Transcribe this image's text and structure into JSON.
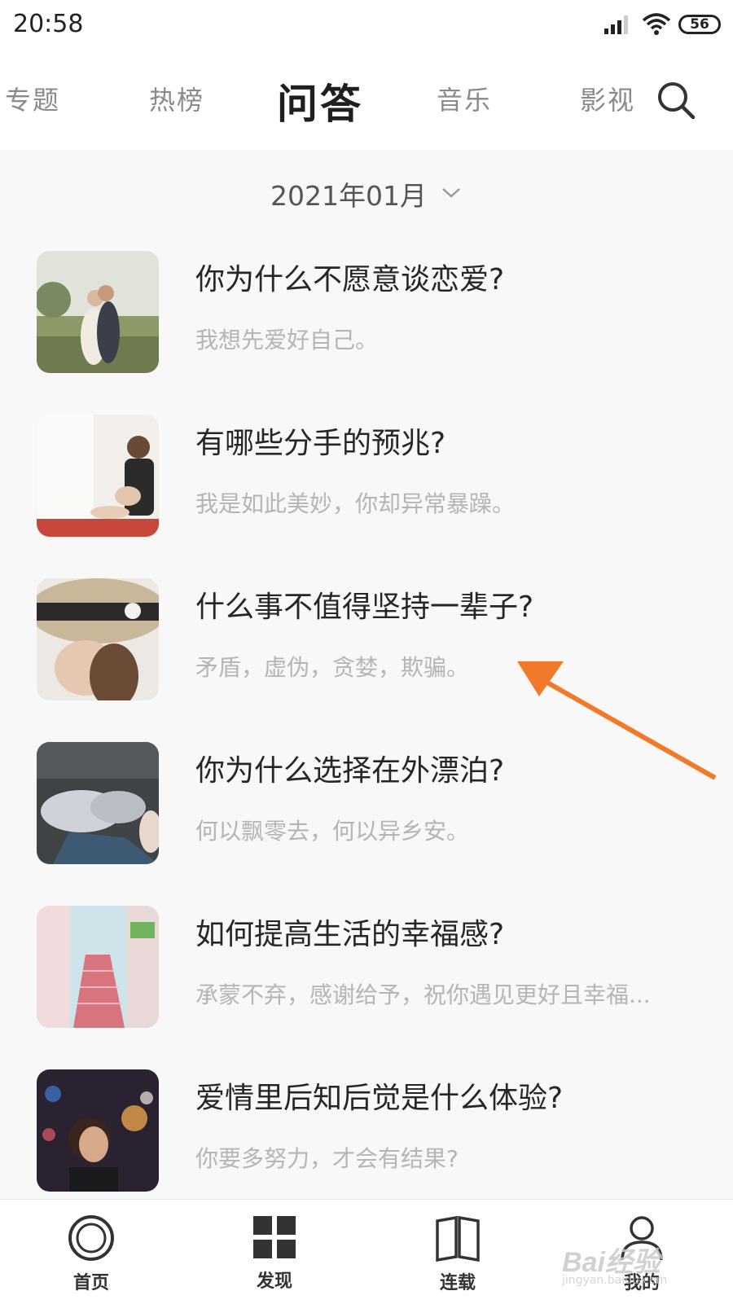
{
  "status_bar": {
    "time": "20:58",
    "battery": "56",
    "icons": [
      "signal-icon",
      "wifi-icon",
      "battery-icon"
    ]
  },
  "top_nav": {
    "tabs": [
      {
        "label": "专题",
        "active": false
      },
      {
        "label": "热榜",
        "active": false
      },
      {
        "label": "问答",
        "active": true
      },
      {
        "label": "音乐",
        "active": false
      },
      {
        "label": "影视",
        "active": false
      }
    ],
    "search_icon": "search-icon"
  },
  "month_picker": {
    "label": "2021年01月",
    "icon": "chevron-down-icon"
  },
  "qa_list": [
    {
      "title": "你为什么不愿意谈恋爱?",
      "subtitle": "我想先爱好自己。",
      "thumb": "couple-kissing-photo"
    },
    {
      "title": "有哪些分手的预兆?",
      "subtitle": "我是如此美妙，你却异常暴躁。",
      "thumb": "woman-by-window-photo"
    },
    {
      "title": "什么事不值得坚持一辈子?",
      "subtitle": "矛盾，虚伪，贪婪，欺骗。",
      "thumb": "woman-straw-hat-photo"
    },
    {
      "title": "你为什么选择在外漂泊?",
      "subtitle": "何以飘零去，何以异乡安。",
      "thumb": "bed-pillows-photo"
    },
    {
      "title": "如何提高生活的幸福感?",
      "subtitle": "承蒙不弃，感谢给予，祝你遇见更好且幸福...",
      "thumb": "pink-stairs-photo"
    },
    {
      "title": "爱情里后知后觉是什么体验?",
      "subtitle": "你要多努力，才会有结果?",
      "thumb": "woman-night-lights-photo"
    }
  ],
  "bottom_nav": {
    "items": [
      {
        "label": "首页",
        "icon": "home-circle-icon"
      },
      {
        "label": "发现",
        "icon": "grid-icon"
      },
      {
        "label": "连载",
        "icon": "book-icon"
      },
      {
        "label": "我的",
        "icon": "user-icon"
      }
    ]
  },
  "watermark": {
    "brand": "Bai经验",
    "url": "jingyan.baidu.com"
  },
  "colors": {
    "annotation_arrow": "#f07a2a",
    "active_tab": "#1f1f1f",
    "inactive_tab": "#8a8a8a",
    "subtitle": "#b5b5b5"
  }
}
